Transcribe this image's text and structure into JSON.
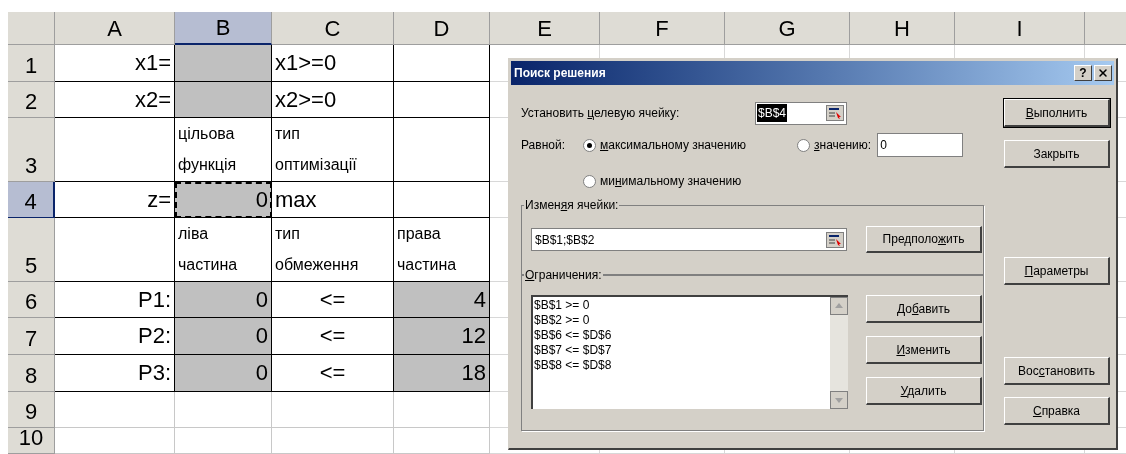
{
  "sheet": {
    "columns": [
      {
        "label": "A",
        "selected": false
      },
      {
        "label": "B",
        "selected": true
      },
      {
        "label": "C",
        "selected": false
      },
      {
        "label": "D",
        "selected": false
      },
      {
        "label": "E",
        "selected": false
      },
      {
        "label": "F",
        "selected": false
      },
      {
        "label": "G",
        "selected": false
      },
      {
        "label": "H",
        "selected": false
      },
      {
        "label": "I",
        "selected": false
      }
    ],
    "rows": [
      {
        "header": "1",
        "selected": false,
        "cells": [
          {
            "text": "x1=",
            "kind": "label",
            "shaded": false,
            "selected": false
          },
          {
            "kind": "empty",
            "shaded": true,
            "selected": false
          },
          {
            "text": "x1>=0",
            "kind": "text",
            "shaded": false,
            "selected": false
          },
          {
            "kind": "empty",
            "shaded": false,
            "selected": false
          }
        ]
      },
      {
        "header": "2",
        "selected": false,
        "cells": [
          {
            "text": "x2=",
            "kind": "label",
            "shaded": false,
            "selected": false
          },
          {
            "kind": "empty",
            "shaded": true,
            "selected": false
          },
          {
            "text": "x2>=0",
            "kind": "text",
            "shaded": false,
            "selected": false
          },
          {
            "kind": "empty",
            "shaded": false,
            "selected": false
          }
        ]
      },
      {
        "header": "3",
        "selected": false,
        "cells": [
          {
            "kind": "empty",
            "shaded": false,
            "selected": false
          },
          {
            "text": "цільова\nфункція",
            "kind": "caption",
            "shaded": false,
            "selected": false
          },
          {
            "text": "тип\nоптимізації",
            "kind": "caption",
            "shaded": false,
            "selected": false
          },
          {
            "kind": "empty",
            "shaded": false,
            "selected": false
          }
        ]
      },
      {
        "header": "4",
        "selected": true,
        "cells": [
          {
            "text": "z=",
            "kind": "label",
            "shaded": false,
            "selected": false
          },
          {
            "text": "0",
            "kind": "number",
            "shaded": true,
            "selected": true
          },
          {
            "text": "max",
            "kind": "text",
            "shaded": false,
            "selected": false
          },
          {
            "kind": "empty",
            "shaded": false,
            "selected": false
          }
        ]
      },
      {
        "header": "5",
        "selected": false,
        "cells": [
          {
            "kind": "empty",
            "shaded": false,
            "selected": false
          },
          {
            "text": "ліва\nчастина",
            "kind": "caption",
            "shaded": false,
            "selected": false
          },
          {
            "text": "тип\nобмеження",
            "kind": "caption",
            "shaded": false,
            "selected": false
          },
          {
            "text": "права\nчастина",
            "kind": "caption",
            "shaded": false,
            "selected": false
          }
        ]
      },
      {
        "header": "6",
        "selected": false,
        "cells": [
          {
            "text": "P1:",
            "kind": "label",
            "shaded": false,
            "selected": false
          },
          {
            "text": "0",
            "kind": "number",
            "shaded": true,
            "selected": false
          },
          {
            "text": "<=",
            "kind": "operator",
            "shaded": false,
            "selected": false
          },
          {
            "text": "4",
            "kind": "number",
            "shaded": true,
            "selected": false
          }
        ]
      },
      {
        "header": "7",
        "selected": false,
        "cells": [
          {
            "text": "P2:",
            "kind": "label",
            "shaded": false,
            "selected": false
          },
          {
            "text": "0",
            "kind": "number",
            "shaded": true,
            "selected": false
          },
          {
            "text": "<=",
            "kind": "operator",
            "shaded": false,
            "selected": false
          },
          {
            "text": "12",
            "kind": "number",
            "shaded": true,
            "selected": false
          }
        ]
      },
      {
        "header": "8",
        "selected": false,
        "cells": [
          {
            "text": "P3:",
            "kind": "label",
            "shaded": false,
            "selected": false
          },
          {
            "text": "0",
            "kind": "number",
            "shaded": true,
            "selected": false
          },
          {
            "text": "<=",
            "kind": "operator",
            "shaded": false,
            "selected": false
          },
          {
            "text": "18",
            "kind": "number",
            "shaded": true,
            "selected": false
          }
        ]
      },
      {
        "header": "9",
        "selected": false
      },
      {
        "header": "10",
        "selected": false
      }
    ]
  },
  "dialog": {
    "title": "Поиск решения",
    "help_button": "?",
    "target": {
      "label": {
        "pre": "Установить ",
        "key": "ц",
        "post": "елевую ячейку:"
      },
      "value": "$B$4",
      "highlighted": true
    },
    "equal_label": "Равной:",
    "options": [
      {
        "label": {
          "key": "м",
          "post": "аксимальному значению"
        },
        "selected": true
      },
      {
        "label": {
          "key": "з",
          "post": "начению:"
        },
        "selected": false
      },
      {
        "label": {
          "pre": "ми",
          "key": "н",
          "post": "имальному значению"
        },
        "selected": false
      }
    ],
    "value_field": "0",
    "changing": {
      "label": {
        "pre": "Измен",
        "key": "я",
        "post": "я ячейки:"
      },
      "value": "$B$1;$B$2",
      "button": {
        "pre": "Предполо",
        "key": "ж",
        "post": "ить"
      }
    },
    "constraints": {
      "label": {
        "key": "О",
        "post": "граничения:"
      },
      "items": [
        "$B$1 >= 0",
        "$B$2 >= 0",
        "$B$6 <= $D$6",
        "$B$7 <= $D$7",
        "$B$8 <= $D$8"
      ],
      "buttons": [
        {
          "pre": "До",
          "key": "б",
          "post": "авить"
        },
        {
          "key": "И",
          "post": "зменить"
        },
        {
          "key": "У",
          "post": "далить"
        }
      ]
    },
    "buttons": [
      {
        "label": {
          "key": "В",
          "post": "ыполнить"
        },
        "default": true
      },
      {
        "label": {
          "pre": "Закрыть"
        },
        "default": false
      },
      {
        "label": {
          "key": "П",
          "post": "араметры"
        },
        "default": false
      },
      {
        "label": {
          "pre": "Вос",
          "key": "с",
          "post": "тановить"
        },
        "default": false
      },
      {
        "label": {
          "key": "С",
          "post": "правка"
        },
        "default": false
      }
    ]
  }
}
